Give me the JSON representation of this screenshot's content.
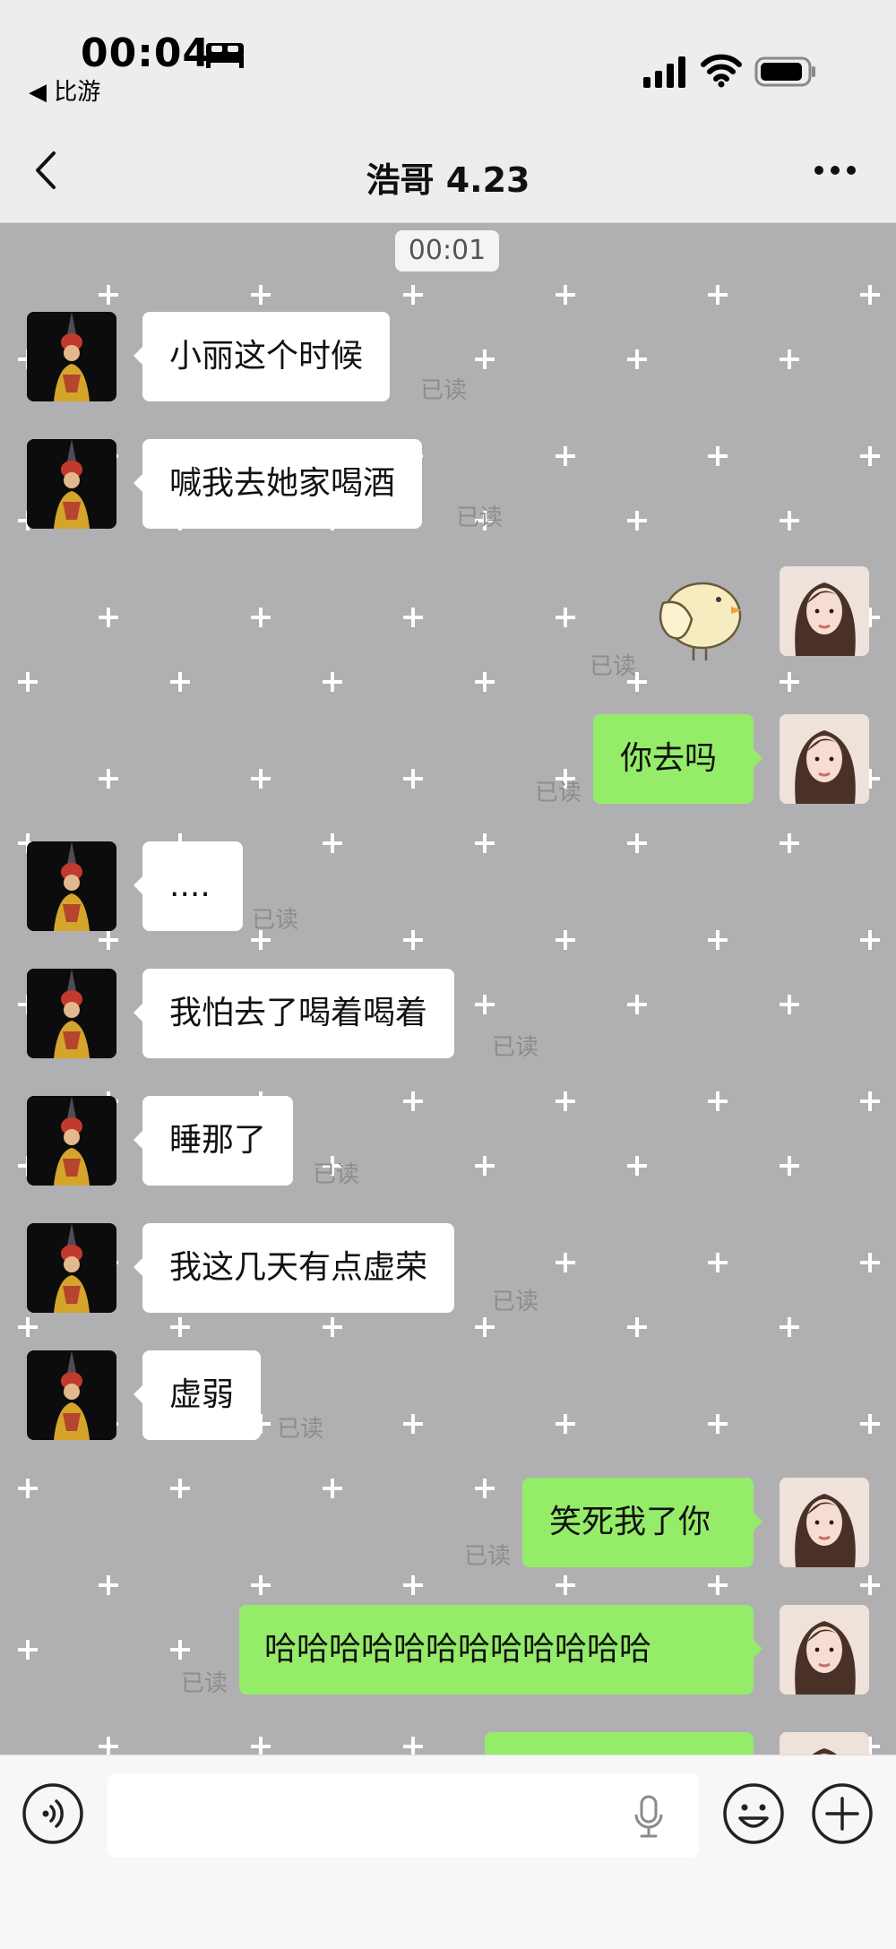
{
  "status_bar": {
    "time": "00:04",
    "back_app": "◀ 比游",
    "icons": [
      "bed-icon",
      "signal-icon",
      "wifi-icon",
      "battery-icon"
    ]
  },
  "nav": {
    "title": "浩哥 4.23",
    "icons": [
      "chevron-left-icon",
      "more-icon"
    ]
  },
  "chat": {
    "date_chip": "00:01",
    "read_label": "已读",
    "messages": [
      {
        "side": "in",
        "text": "小丽这个时候"
      },
      {
        "side": "in",
        "text": "喊我去她家喝酒"
      },
      {
        "side": "out",
        "type": "sticker",
        "sticker": "chick-sticker"
      },
      {
        "side": "out",
        "text": "你去吗"
      },
      {
        "side": "in",
        "text": "...."
      },
      {
        "side": "in",
        "text": "我怕去了喝着喝着"
      },
      {
        "side": "in",
        "text": "睡那了"
      },
      {
        "side": "in",
        "text": "我这几天有点虚荣"
      },
      {
        "side": "in",
        "text": "虚弱"
      },
      {
        "side": "out",
        "text": "笑死我了你"
      },
      {
        "side": "out",
        "text": "哈哈哈哈哈哈哈哈哈哈哈哈"
      },
      {
        "side": "out",
        "text": ""
      }
    ]
  },
  "input_bar": {
    "icons": [
      "voice-icon",
      "mic-icon",
      "emoji-icon",
      "plus-icon"
    ]
  },
  "colors": {
    "outgoing_bubble": "#95ec69",
    "incoming_bubble": "#ffffff",
    "chat_background": "#b0b0b2"
  }
}
